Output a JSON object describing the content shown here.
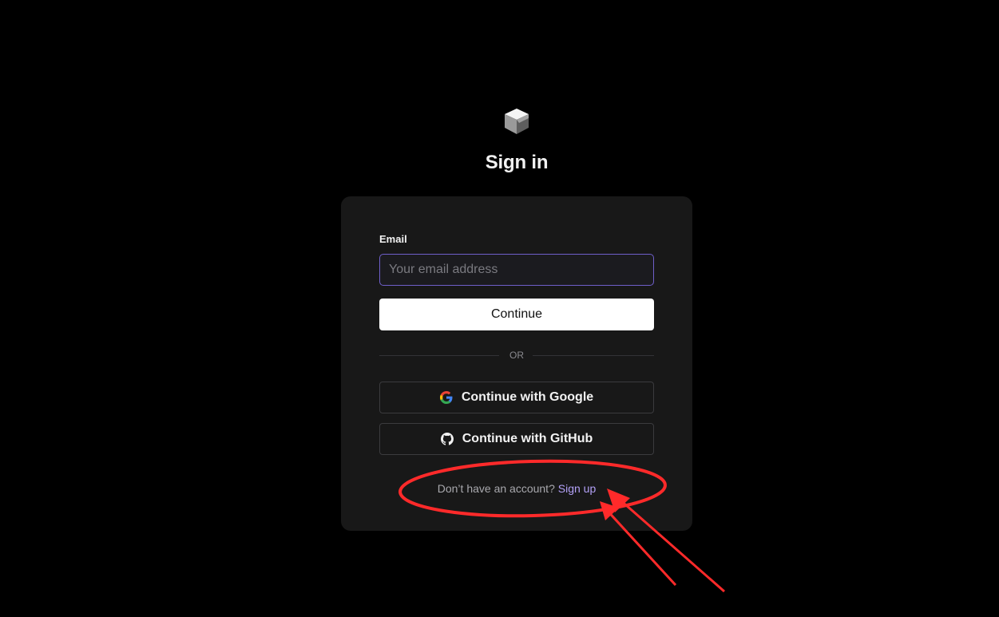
{
  "header": {
    "logo_icon": "cube-logo-icon",
    "title": "Sign in"
  },
  "form": {
    "email_label": "Email",
    "email_value": "",
    "email_placeholder": "Your email address",
    "continue_label": "Continue"
  },
  "divider": {
    "text": "OR"
  },
  "oauth": {
    "google": {
      "label": "Continue with Google",
      "icon": "google-icon"
    },
    "github": {
      "label": "Continue with GitHub",
      "icon": "github-icon"
    }
  },
  "footer": {
    "prompt": "Don’t have an account?",
    "signup_label": "Sign up"
  },
  "colors": {
    "background": "#000000",
    "card": "#181818",
    "input_focus_border": "#6f5fc9",
    "link": "#b3a1f7",
    "annotation": "#ff2a2a"
  }
}
